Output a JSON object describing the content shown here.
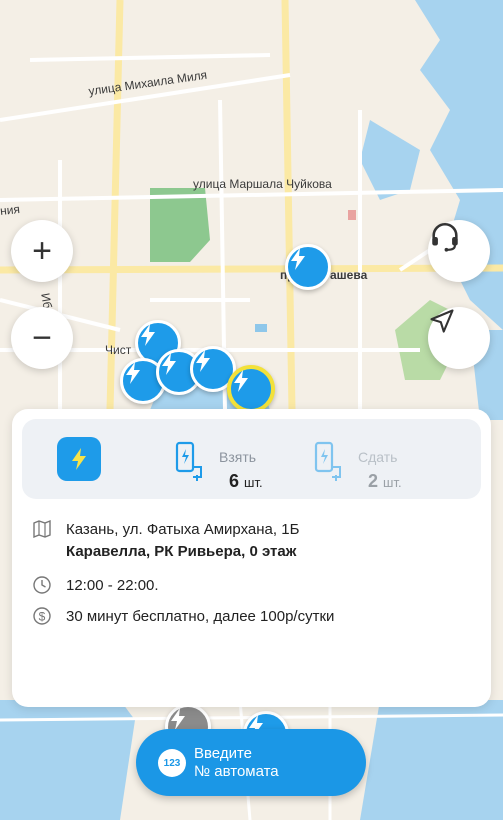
{
  "map": {
    "streets": [
      "улица Михаила Миля",
      "улица Маршала Чуйкова",
      "просп",
      "ашева",
      "Ибрагимова",
      "Чист",
      "ния"
    ]
  },
  "controls": {
    "zoom_in": "+",
    "zoom_out": "−"
  },
  "station": {
    "take_label": "Взять",
    "take_count": "6",
    "take_unit": "шт.",
    "return_label": "Сдать",
    "return_count": "2",
    "return_unit": "шт.",
    "address": "Казань, ул. Фатыха Амирхана, 1Б",
    "place": "Каравелла, РК Ривьера, 0 этаж",
    "hours": "12:00 - 22:00.",
    "tariff": "30 минут бесплатно, далее 100р/сутки"
  },
  "cta": {
    "badge": "123",
    "line1": "Введите",
    "line2": "№ автомата"
  },
  "colors": {
    "accent": "#1e9be9",
    "selected_ring": "#f2e13a",
    "water": "#a7d3ef",
    "park": "#8dc88f"
  }
}
